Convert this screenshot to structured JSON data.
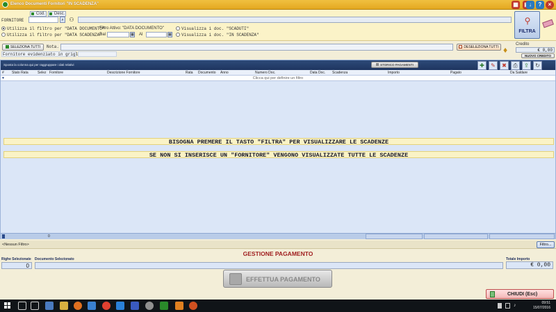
{
  "window": {
    "title": "Elenco Documenti Fornitori \"IN SCADENZA\""
  },
  "filter": {
    "tabs": [
      "Cod.",
      "Desc."
    ],
    "fornitore_label": "FORNITORE",
    "opt_data_documento": "Utilizza il filtro per \"DATA DOCUMENTO\"",
    "opt_data_scadenza": "Utilizza il filtro per \"DATA SCADENZA\"",
    "filtro_attivo": "Filtro Attivo: \"DATA DOCUMENTO\"",
    "dal_label": "Dal",
    "al_label": "Al",
    "opt_scaduti": "Visualizza i doc. \"SCADUTI\"",
    "opt_in_scadenza": "Visualizza i doc. \"IN SCADENZA\"",
    "filtra_label": "FILTRA"
  },
  "actions": {
    "seleziona_tutti": "SELEZIONA TUTTI",
    "nota_label": "Nota.",
    "fornitore_evidenziato": "Fornitore evidenziato in griglia.",
    "deseleziona_tutti": "DESELEZIONA TUTTI",
    "credito_label": "Credito",
    "credito_value": "€ 0,00",
    "nuovo_credito": "NUOVO CREDITO"
  },
  "grid": {
    "group_hint": "Sposta la colonna qui per raggruppare i dati relativi",
    "storico_pagamenti": "STORICO PAGAMENTI",
    "columns": [
      "#",
      "Stato Rata",
      "Selez",
      "Fornitore",
      "Descrizione Fornitore",
      "Rata",
      "Documento",
      "Anno",
      "Numero Doc.",
      "Data Doc.",
      "Scadenza",
      "Importo",
      "Pagato",
      "Da Saldare"
    ],
    "filter_row_hint": "Clicca qui per definire un filtro",
    "message_1": "BISOGNA PREMERE IL TASTO \"FILTRA\" PER VISUALIZZARE LE SCADENZE",
    "message_2": "SE NON SI INSERISCE UN \"FORNITORE\" VENGONO VISUALIZZATE TUTTE LE SCADENZE",
    "footer_count": "0"
  },
  "filter_status": {
    "text": "<Nessun Filtro>",
    "button": "Filtro..."
  },
  "payment": {
    "title": "GESTIONE PAGAMENTO",
    "righe_label": "Righe Selezionate",
    "righe_value": "0",
    "documento_label": "Documento Selezionato",
    "totale_label": "Totale Importo",
    "totale_value": "€ 0,00",
    "effettua_label": "EFFETTUA PAGAMENTO"
  },
  "chiudi_label": "CHIUDI  (Esc)",
  "taskbar": {
    "time": "09:51",
    "date": "15/07/2016"
  },
  "colors": {
    "title_bar": "#e4a820",
    "grid_header": "#1e3560",
    "banner": "#faf3c6",
    "payment_title": "#a02020"
  }
}
